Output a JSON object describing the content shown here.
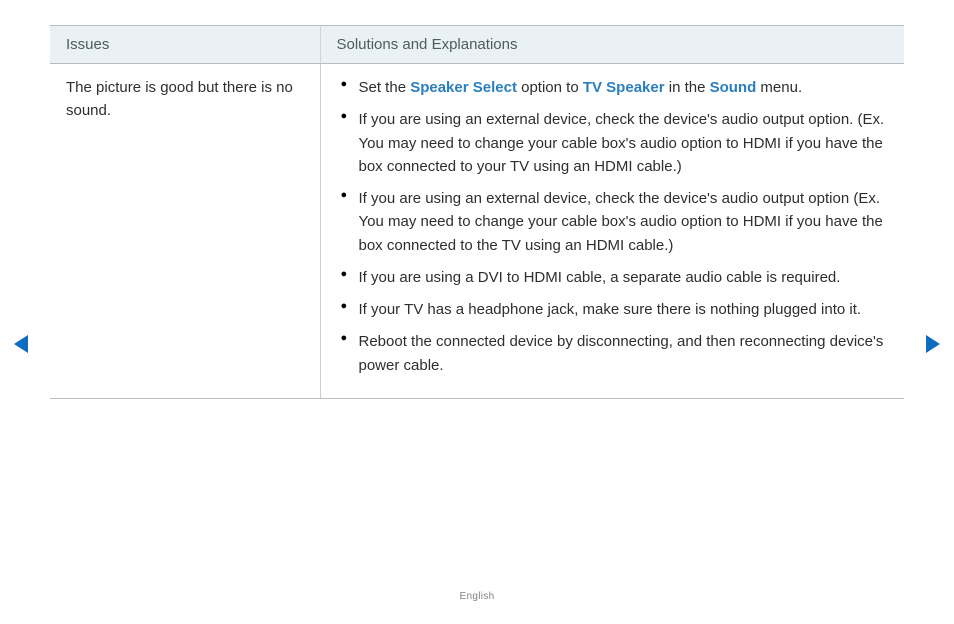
{
  "table": {
    "headers": {
      "issues": "Issues",
      "solutions": "Solutions and Explanations"
    },
    "row": {
      "issue": "The picture is good but there is no sound.",
      "solutions": [
        {
          "segments": [
            {
              "text": "Set the "
            },
            {
              "text": "Speaker Select",
              "keyword": true
            },
            {
              "text": " option to "
            },
            {
              "text": "TV Speaker",
              "keyword": true
            },
            {
              "text": " in the "
            },
            {
              "text": "Sound",
              "keyword": true
            },
            {
              "text": " menu."
            }
          ]
        },
        {
          "segments": [
            {
              "text": "If you are using an external device, check the device's audio output option. (Ex. You may need to change your cable box's audio option to HDMI if you have the box connected to your TV using an HDMI cable.)"
            }
          ]
        },
        {
          "segments": [
            {
              "text": "If you are using an external device, check the device's audio output option (Ex. You may need to change your cable box's audio option to HDMI if you have the box connected to the TV using an HDMI cable.)"
            }
          ]
        },
        {
          "segments": [
            {
              "text": "If you are using a DVI to HDMI cable, a separate audio cable is required."
            }
          ]
        },
        {
          "segments": [
            {
              "text": "If your TV has a headphone jack, make sure there is nothing plugged into it."
            }
          ]
        },
        {
          "segments": [
            {
              "text": "Reboot the connected device by disconnecting, and then reconnecting device's power cable."
            }
          ]
        }
      ]
    }
  },
  "footer": {
    "language": "English"
  },
  "colors": {
    "keyword": "#2a7fbf",
    "arrow": "#0b6cc0"
  }
}
